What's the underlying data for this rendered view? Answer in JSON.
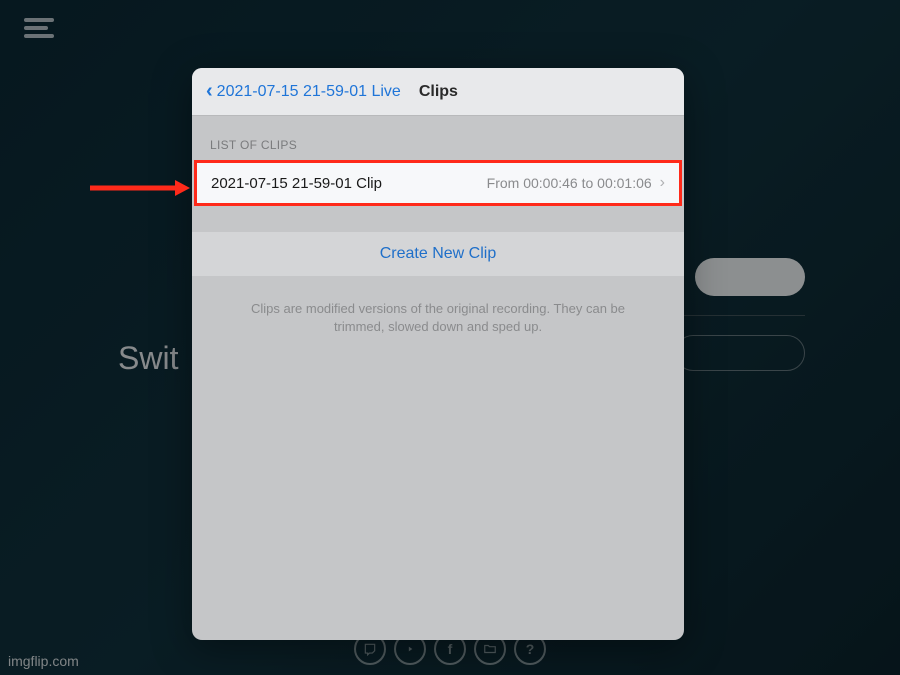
{
  "background": {
    "partial_text": "Swit"
  },
  "modal": {
    "back_label": "2021-07-15 21-59-01 Live",
    "title": "Clips",
    "section_label": "LIST OF CLIPS",
    "clip": {
      "name": "2021-07-15 21-59-01 Clip",
      "time_range": "From 00:00:46 to 00:01:06"
    },
    "create_label": "Create New Clip",
    "help_text": "Clips are modified versions of the original recording. They can be trimmed, slowed down and sped up."
  },
  "watermark": "imgflip.com",
  "social_icons": [
    "twitch-icon",
    "youtube-icon",
    "facebook-icon",
    "folder-icon",
    "help-icon"
  ]
}
